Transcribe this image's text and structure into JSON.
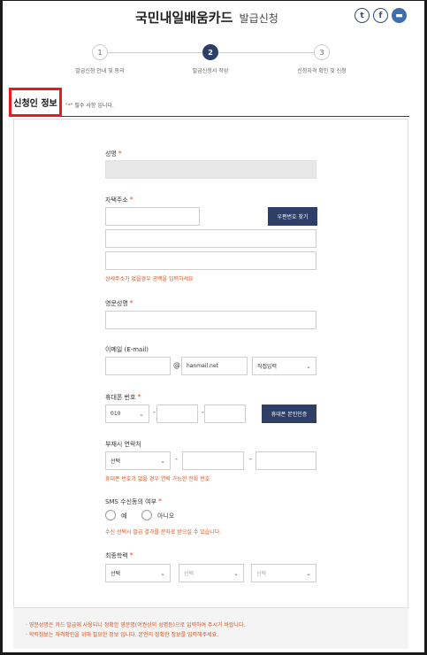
{
  "header": {
    "title": "국민내일배움카드",
    "subtitle": "발급신청",
    "share": [
      {
        "icon": "twitter-icon",
        "glyph": "t"
      },
      {
        "icon": "facebook-icon",
        "glyph": "f"
      },
      {
        "icon": "print-icon",
        "glyph": "▬"
      }
    ]
  },
  "steps": [
    {
      "num": "1",
      "label": "발급신청 안내 및 동의"
    },
    {
      "num": "2",
      "label": "발급신청서 작성"
    },
    {
      "num": "3",
      "label": "신청자격 확인 및 신청"
    }
  ],
  "section": {
    "title": "신청인 정보",
    "required_prefix": "\"",
    "required_mark": "*",
    "required_suffix": "\" 필수 사항 입니다."
  },
  "form": {
    "required_mark": "*",
    "name": {
      "label": "성명",
      "value": ""
    },
    "address": {
      "label": "자택주소",
      "zip_button": "우편번호 찾기",
      "warning": "상세주소가 없을경우 공백을 입력하세요"
    },
    "english_name": {
      "label": "영문성명"
    },
    "email": {
      "label": "이메일 (E-mail)",
      "at": "@",
      "domain": "hanmail.net",
      "domain_select": "직접입력"
    },
    "mobile": {
      "label": "휴대폰 번호",
      "prefix": "010",
      "dash": "-",
      "verify_button": "휴대폰 본인인증"
    },
    "alt_phone": {
      "label": "부재시 연락처",
      "select": "선택",
      "dash": "-",
      "warning": "휴대폰 번호가 없을 경우 연락 가능한 전화 번호"
    },
    "sms": {
      "label": "SMS 수신동의 여부",
      "options": [
        "예",
        "아니오"
      ],
      "warning": "수신 선택시 발급 결과를 문자로 받으실 수 있습니다."
    },
    "education": {
      "label": "최종학력",
      "selects": [
        "선택",
        "선택",
        "선택"
      ]
    }
  },
  "footnotes": [
    "영문성명은 카드 발급에 사용되니 정확한 영문명(여권상의 성명등)으로 입력하여 주시기 바랍니다.",
    "학력정보는 자격확인을 위해 필요한 정보 입니다. 본인의 정확한 정보를 입력해주세요."
  ]
}
